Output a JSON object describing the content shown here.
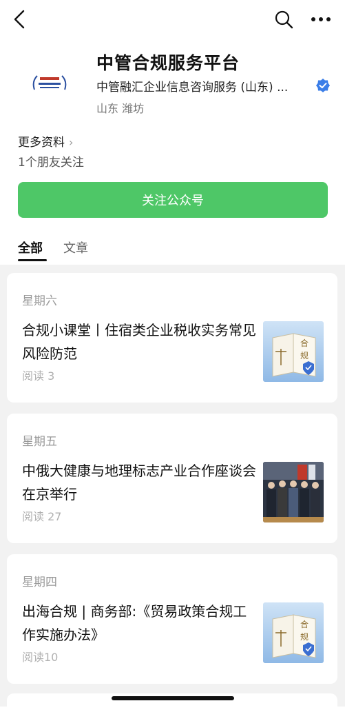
{
  "account": {
    "name": "中管合规服务平台",
    "subject": "中管融汇企业信息咨询服务 (山东) ...",
    "region": "山东 潍坊",
    "more_info": "更多资料",
    "friends_following": "1个朋友关注",
    "follow_button": "关注公众号"
  },
  "tabs": [
    {
      "label": "全部"
    },
    {
      "label": "文章"
    }
  ],
  "articles": [
    {
      "day": "星期六",
      "title": "合规小课堂丨住宿类企业税收实务常见风险防范",
      "reads": "阅读 3",
      "thumb_text": "合规"
    },
    {
      "day": "星期五",
      "title": "中俄大健康与地理标志产业合作座谈会在京举行",
      "reads": "阅读 27"
    },
    {
      "day": "星期四",
      "title": "出海合规 | 商务部:《贸易政策合规工作实施办法》",
      "reads": "阅读10",
      "thumb_text": "合规"
    }
  ],
  "colors": {
    "follow_green": "#4ec767",
    "verify_blue": "#3b7ee8"
  }
}
